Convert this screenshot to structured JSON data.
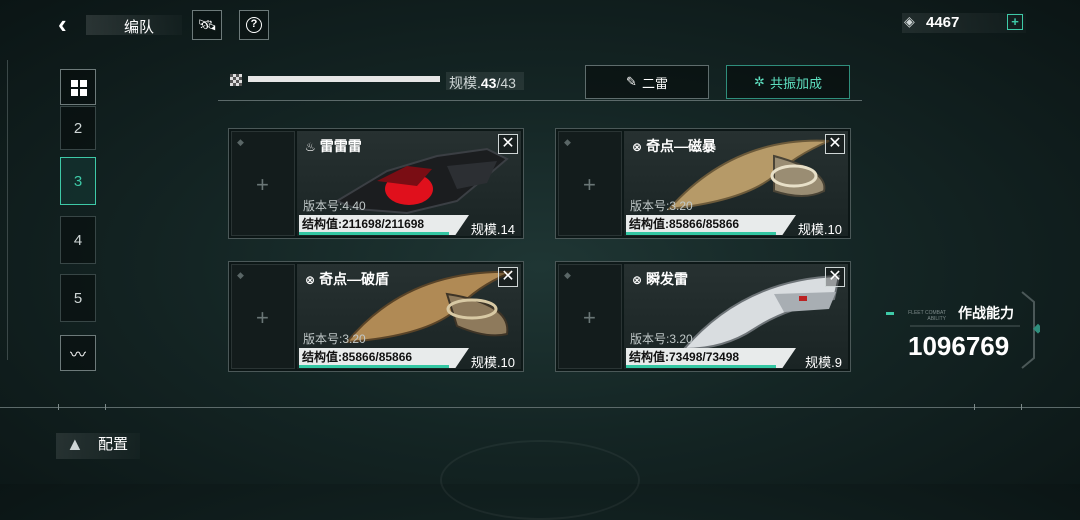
{
  "header": {
    "back_icon": "back-chevron-icon",
    "title": "编队",
    "rocket_icon": "rocket-icon",
    "help_icon": "help-icon",
    "resource_icon": "crystal-icon",
    "resource_value": "4467",
    "add_label": "+"
  },
  "fleet_slots": {
    "grid_icon": "grid-icon",
    "items": [
      {
        "label": "2"
      },
      {
        "label": "3",
        "active": true
      },
      {
        "label": "4"
      },
      {
        "label": "5"
      }
    ],
    "wave_icon": "wave-icon"
  },
  "scale": {
    "label": "规模.",
    "current": "43",
    "max": "/43",
    "progress": 1.0
  },
  "actions": {
    "edit_label": "二雷",
    "resonance_label": "共振加成"
  },
  "ships": [
    {
      "name": "雷雷雷",
      "version": "版本号:4.40",
      "structure": "结构值:211698/211698",
      "scale": "规模.14",
      "structure_ratio": 1.0
    },
    {
      "name": "奇点—磁暴",
      "version": "版本号:3.20",
      "structure": "结构值:85866/85866",
      "scale": "规模.10",
      "structure_ratio": 1.0
    },
    {
      "name": "奇点—破盾",
      "version": "版本号:3.20",
      "structure": "结构值:85866/85866",
      "scale": "规模.10",
      "structure_ratio": 1.0
    },
    {
      "name": "瞬发雷",
      "version": "版本号:3.20",
      "structure": "结构值:73498/73498",
      "scale": "规模.9",
      "structure_ratio": 1.0
    }
  ],
  "power": {
    "label": "作战能力",
    "tiny_label": "FLEET COMBAT ABILITY",
    "value": "1096769"
  },
  "footer": {
    "config_label": "配置"
  },
  "colors": {
    "accent": "#3ec9a7",
    "background": "#142524"
  }
}
